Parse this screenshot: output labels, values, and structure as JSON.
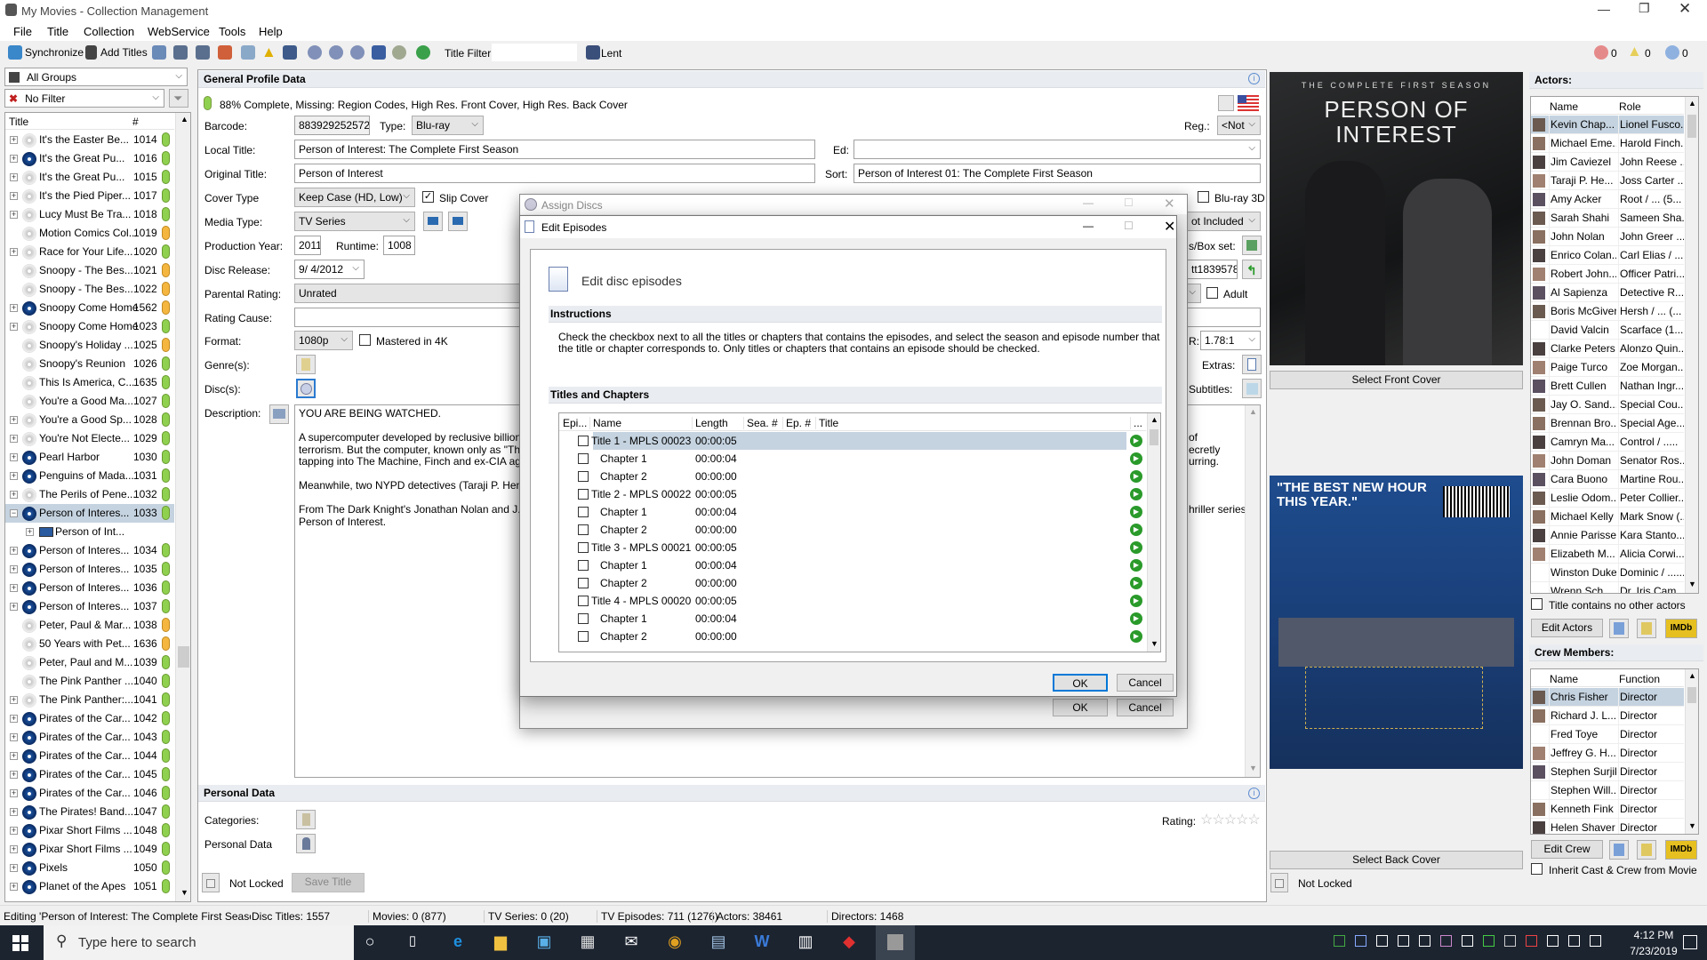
{
  "window": {
    "title": "My Movies - Collection Management"
  },
  "menu": [
    "File",
    "Title",
    "Collection",
    "WebService",
    "Tools",
    "Help"
  ],
  "toolbar": {
    "synchronize": "Synchronize",
    "add_titles": "Add Titles",
    "title_filter_label": "Title Filter",
    "title_filter_value": "",
    "lent": "Lent",
    "errors": "0",
    "warnings": "0",
    "infos": "0"
  },
  "left": {
    "group": "All Groups",
    "filter": "No Filter",
    "col_title": "Title",
    "col_num": "#",
    "rows": [
      {
        "title": "It's the Easter Be...",
        "num": "1014",
        "status": "green",
        "media": "dvd",
        "expand": "+"
      },
      {
        "title": "It's the Great Pu...",
        "num": "1016",
        "status": "green",
        "media": "bluray",
        "expand": "+"
      },
      {
        "title": "It's the Great Pu...",
        "num": "1015",
        "status": "green",
        "media": "dvd",
        "expand": "+"
      },
      {
        "title": "It's the Pied Piper...",
        "num": "1017",
        "status": "green",
        "media": "dvd",
        "expand": "+"
      },
      {
        "title": "Lucy Must Be Tra...",
        "num": "1018",
        "status": "green",
        "media": "dvd",
        "expand": "+"
      },
      {
        "title": "Motion Comics Col...",
        "num": "1019",
        "status": "orange",
        "media": "dvd",
        "expand": ""
      },
      {
        "title": "Race for Your Life...",
        "num": "1020",
        "status": "green",
        "media": "dvd",
        "expand": "+"
      },
      {
        "title": "Snoopy - The Bes...",
        "num": "1021",
        "status": "orange",
        "media": "dvd",
        "expand": ""
      },
      {
        "title": "Snoopy - The Bes...",
        "num": "1022",
        "status": "orange",
        "media": "dvd",
        "expand": ""
      },
      {
        "title": "Snoopy Come Home",
        "num": "1562",
        "status": "orange",
        "media": "bluray",
        "expand": "+"
      },
      {
        "title": "Snoopy Come Home",
        "num": "1023",
        "status": "green",
        "media": "dvd",
        "expand": "+"
      },
      {
        "title": "Snoopy's Holiday ...",
        "num": "1025",
        "status": "orange",
        "media": "dvd",
        "expand": ""
      },
      {
        "title": "Snoopy's Reunion",
        "num": "1026",
        "status": "green",
        "media": "dvd",
        "expand": ""
      },
      {
        "title": "This Is America, C...",
        "num": "1635",
        "status": "green",
        "media": "dvd",
        "expand": ""
      },
      {
        "title": "You're a Good Ma...",
        "num": "1027",
        "status": "green",
        "media": "dvd",
        "expand": ""
      },
      {
        "title": "You're a Good Sp...",
        "num": "1028",
        "status": "green",
        "media": "dvd",
        "expand": "+"
      },
      {
        "title": "You're Not Electe...",
        "num": "1029",
        "status": "green",
        "media": "dvd",
        "expand": "+"
      },
      {
        "title": "Pearl Harbor",
        "num": "1030",
        "status": "green",
        "media": "bluray",
        "expand": "+"
      },
      {
        "title": "Penguins of Mada...",
        "num": "1031",
        "status": "green",
        "media": "bluray",
        "expand": "+"
      },
      {
        "title": "The Perils of Pene...",
        "num": "1032",
        "status": "green",
        "media": "dvd",
        "expand": "+"
      },
      {
        "title": "Person of Interes...",
        "num": "1033",
        "status": "green",
        "media": "bluray",
        "expand": "-",
        "selected": true
      },
      {
        "title": "Person of Int...",
        "num": "",
        "status": "",
        "media": "tv",
        "expand": "+",
        "child": true
      },
      {
        "title": "Person of Interes...",
        "num": "1034",
        "status": "green",
        "media": "bluray",
        "expand": "+"
      },
      {
        "title": "Person of Interes...",
        "num": "1035",
        "status": "green",
        "media": "bluray",
        "expand": "+"
      },
      {
        "title": "Person of Interes...",
        "num": "1036",
        "status": "green",
        "media": "bluray",
        "expand": "+"
      },
      {
        "title": "Person of Interes...",
        "num": "1037",
        "status": "green",
        "media": "bluray",
        "expand": "+"
      },
      {
        "title": "Peter, Paul & Mar...",
        "num": "1038",
        "status": "orange",
        "media": "dvd",
        "expand": ""
      },
      {
        "title": "50 Years with Pet...",
        "num": "1636",
        "status": "orange",
        "media": "dvd",
        "expand": ""
      },
      {
        "title": "Peter, Paul and M...",
        "num": "1039",
        "status": "green",
        "media": "dvd",
        "expand": ""
      },
      {
        "title": "The Pink Panther ...",
        "num": "1040",
        "status": "green",
        "media": "dvd",
        "expand": ""
      },
      {
        "title": "The Pink Panther:...",
        "num": "1041",
        "status": "green",
        "media": "dvd",
        "expand": "+"
      },
      {
        "title": "Pirates of the Car...",
        "num": "1042",
        "status": "green",
        "media": "bluray",
        "expand": "+"
      },
      {
        "title": "Pirates of the Car...",
        "num": "1043",
        "status": "green",
        "media": "bluray",
        "expand": "+"
      },
      {
        "title": "Pirates of the Car...",
        "num": "1044",
        "status": "green",
        "media": "bluray",
        "expand": "+"
      },
      {
        "title": "Pirates of the Car...",
        "num": "1045",
        "status": "green",
        "media": "bluray",
        "expand": "+"
      },
      {
        "title": "Pirates of the Car...",
        "num": "1046",
        "status": "green",
        "media": "bluray",
        "expand": "+"
      },
      {
        "title": "The Pirates! Band...",
        "num": "1047",
        "status": "green",
        "media": "bluray",
        "expand": "+"
      },
      {
        "title": "Pixar Short Films ...",
        "num": "1048",
        "status": "green",
        "media": "bluray",
        "expand": "+"
      },
      {
        "title": "Pixar Short Films ...",
        "num": "1049",
        "status": "green",
        "media": "bluray",
        "expand": "+"
      },
      {
        "title": "Pixels",
        "num": "1050",
        "status": "green",
        "media": "bluray",
        "expand": "+"
      },
      {
        "title": "Planet of the Apes",
        "num": "1051",
        "status": "green",
        "media": "bluray",
        "expand": "+"
      }
    ]
  },
  "profile": {
    "header": "General Profile Data",
    "completeness": "88% Complete, Missing: Region Codes, High Res. Front Cover, High Res. Back Cover",
    "barcode_label": "Barcode:",
    "barcode": "883929252572",
    "type_label": "Type:",
    "type": "Blu-ray",
    "reg_label": "Reg.:",
    "reg": "<Not",
    "local_title_label": "Local Title:",
    "local_title": "Person of Interest: The Complete First Season",
    "ed_label": "Ed:",
    "ed": "",
    "original_title_label": "Original Title:",
    "original_title": "Person of Interest",
    "sort_label": "Sort:",
    "sort": "Person of Interest 01: The Complete First Season",
    "cover_type_label": "Cover Type",
    "cover_type": "Keep Case (HD, Low)",
    "slip_cover": "Slip Cover",
    "bluray3d": "Blu-ray 3D",
    "media_type_label": "Media Type:",
    "media_type": "TV Series",
    "not_included": "ot Included",
    "production_year_label": "Production Year:",
    "production_year": "2011",
    "runtime_label": "Runtime:",
    "runtime": "1008",
    "box_set_label": "s/Box set:",
    "disc_release_label": "Disc Release:",
    "disc_release": "9/  4/2012",
    "imdb_id": "tt1839578",
    "parental_rating_label": "Parental Rating:",
    "parental_rating": "Unrated",
    "adult": "Adult",
    "rating_cause_label": "Rating Cause:",
    "rating_cause": "",
    "format_label": "Format:",
    "format": "1080p",
    "mastered_4k": "Mastered in 4K",
    "aspect_label": "R:",
    "aspect": "1.78:1",
    "genres_label": "Genre(s):",
    "extras_label": "Extras:",
    "discs_label": "Disc(s):",
    "subtitles_label": "Subtitles:",
    "description_label": "Description:",
    "description_left": [
      "YOU ARE BEING WATCHED.",
      "",
      "A supercomputer developed by reclusive billiona",
      "terrorism. But the computer, known only as \"The",
      "tapping into The Machine, Finch and ex-CIA age",
      "",
      "Meanwhile, two NYPD detectives (Taraji P. Henso",
      "",
      "From The Dark Knight's Jonathan Nolan and J.J.",
      "Person of Interest."
    ],
    "description_right": [
      "",
      "",
      "of",
      "ecretly",
      "urring.",
      "",
      "",
      "",
      "hriller series",
      ""
    ]
  },
  "personal": {
    "header": "Personal Data",
    "categories_label": "Categories:",
    "personal_data_label": "Personal Data",
    "rating_label": "Rating:",
    "rating_stars": 0,
    "not_locked": "Not Locked",
    "save_title": "Save Title"
  },
  "covers": {
    "front_tagline": "THE COMPLETE FIRST SEASON",
    "front_logo": "PERSON OF INTEREST",
    "select_front": "Select Front Cover",
    "back_quote": "\"THE BEST NEW HOUR THIS YEAR.\"",
    "select_back": "Select Back Cover",
    "not_locked": "Not Locked"
  },
  "actors": {
    "header": "Actors:",
    "col_name": "Name",
    "col_role": "Role",
    "rows": [
      [
        "Kevin Chap...",
        "Lionel Fusco..."
      ],
      [
        "Michael Eme...",
        "Harold Finch..."
      ],
      [
        "Jim Caviezel",
        "John Reese ..."
      ],
      [
        "Taraji P. He...",
        "Joss Carter ..."
      ],
      [
        "Amy Acker",
        "Root / ... (5..."
      ],
      [
        "Sarah Shahi",
        "Sameen Sha..."
      ],
      [
        "John Nolan",
        "John Greer ..."
      ],
      [
        "Enrico Colan...",
        "Carl Elias / ...."
      ],
      [
        "Robert John...",
        "Officer Patri..."
      ],
      [
        "Al Sapienza",
        "Detective R..."
      ],
      [
        "Boris McGiver",
        "Hersh / ... (..."
      ],
      [
        "David Valcin",
        "Scarface (1..."
      ],
      [
        "Clarke Peters",
        "Alonzo Quin..."
      ],
      [
        "Paige Turco",
        "Zoe Morgan..."
      ],
      [
        "Brett Cullen",
        "Nathan Ingr..."
      ],
      [
        "Jay O. Sand...",
        "Special Cou..."
      ],
      [
        "Brennan Bro...",
        "Special Age..."
      ],
      [
        "Camryn Ma...",
        "Control / ....."
      ],
      [
        "John Doman",
        "Senator Ros..."
      ],
      [
        "Cara Buono",
        "Martine Rou..."
      ],
      [
        "Leslie Odom...",
        "Peter Collier..."
      ],
      [
        "Michael Kelly",
        "Mark Snow (..."
      ],
      [
        "Annie Parisse",
        "Kara Stanto..."
      ],
      [
        "Elizabeth M...",
        "Alicia Corwi..."
      ],
      [
        "Winston Duke",
        "Dominic / ......"
      ],
      [
        "Wrenn Sch...",
        "Dr. Iris Cam..."
      ]
    ],
    "no_photo": [
      11,
      24,
      25
    ],
    "no_other_actors": "Title contains no other actors",
    "edit_actors": "Edit Actors",
    "imdb": "IMDb"
  },
  "crew": {
    "header": "Crew Members:",
    "col_name": "Name",
    "col_function": "Function",
    "rows": [
      [
        "Chris Fisher",
        "Director"
      ],
      [
        "Richard J. L...",
        "Director"
      ],
      [
        "Fred Toye",
        "Director"
      ],
      [
        "Jeffrey G. H...",
        "Director"
      ],
      [
        "Stephen Surjik",
        "Director"
      ],
      [
        "Stephen Will...",
        "Director"
      ],
      [
        "Kenneth Fink",
        "Director"
      ],
      [
        "Helen Shaver",
        "Director"
      ]
    ],
    "no_photo": [
      2,
      5
    ],
    "edit_crew": "Edit Crew",
    "imdb": "IMDb",
    "inherit": "Inherit Cast & Crew from Movie"
  },
  "assign_dialog": {
    "title": "Assign Discs",
    "ok": "OK",
    "cancel": "Cancel"
  },
  "episodes_dialog": {
    "title": "Edit Episodes",
    "heading": "Edit disc episodes",
    "instructions_header": "Instructions",
    "instructions": [
      "Check the checkbox next to all the titles or chapters that contains the episodes, and select the season and episode number that",
      "the title or chapter corresponds to. Only titles or chapters that contains an episode should be checked."
    ],
    "titles_header": "Titles and Chapters",
    "columns": [
      "Epi...",
      "Name",
      "Length",
      "Sea. #",
      "Ep. #",
      "Title",
      "..."
    ],
    "rows": [
      {
        "name": "Title 1 - MPLS 00023",
        "length": "00:00:05",
        "type": "title",
        "selected": true
      },
      {
        "name": "Chapter 1",
        "length": "00:00:04",
        "type": "chapter"
      },
      {
        "name": "Chapter 2",
        "length": "00:00:00",
        "type": "chapter"
      },
      {
        "name": "Title 2 - MPLS 00022",
        "length": "00:00:05",
        "type": "title"
      },
      {
        "name": "Chapter 1",
        "length": "00:00:04",
        "type": "chapter"
      },
      {
        "name": "Chapter 2",
        "length": "00:00:00",
        "type": "chapter"
      },
      {
        "name": "Title 3 - MPLS 00021",
        "length": "00:00:05",
        "type": "title"
      },
      {
        "name": "Chapter 1",
        "length": "00:00:04",
        "type": "chapter"
      },
      {
        "name": "Chapter 2",
        "length": "00:00:00",
        "type": "chapter"
      },
      {
        "name": "Title 4 - MPLS 00020",
        "length": "00:00:05",
        "type": "title"
      },
      {
        "name": "Chapter 1",
        "length": "00:00:04",
        "type": "chapter"
      },
      {
        "name": "Chapter 2",
        "length": "00:00:00",
        "type": "chapter"
      }
    ],
    "ok": "OK",
    "cancel": "Cancel"
  },
  "status": [
    "Editing 'Person of Interest: The Complete First Season",
    "Disc Titles: 1557",
    "Movies: 0 (877)",
    "TV Series: 0 (20)",
    "TV Episodes: 711 (1276)",
    "Actors: 38461",
    "Directors: 1468"
  ],
  "taskbar": {
    "search_placeholder": "Type here to search",
    "time": "4:12 PM",
    "date": "7/23/2019"
  },
  "colors": {
    "selection": "#c5d3e0",
    "band": "#e9ecf0",
    "status_green": "#8fd14f",
    "status_orange": "#f5b640",
    "taskbar": "#1c2430",
    "dialog_ok_border": "#0078d7"
  }
}
